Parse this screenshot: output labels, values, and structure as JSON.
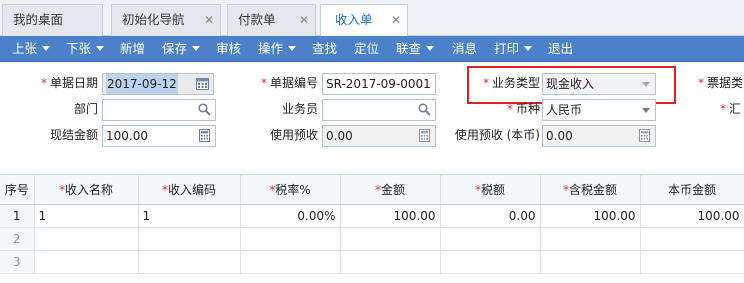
{
  "tabs": [
    {
      "label": "我的桌面",
      "closable": false,
      "active": false
    },
    {
      "label": "初始化导航",
      "closable": true,
      "active": false
    },
    {
      "label": "付款单",
      "closable": true,
      "active": false
    },
    {
      "label": "收入单",
      "closable": true,
      "active": true
    }
  ],
  "toolbar": {
    "items": [
      {
        "label": "上张",
        "dropdown": true
      },
      {
        "label": "下张",
        "dropdown": true
      },
      {
        "label": "新增",
        "dropdown": false
      },
      {
        "label": "保存",
        "dropdown": true
      },
      {
        "label": "审核",
        "dropdown": false
      },
      {
        "label": "操作",
        "dropdown": true
      },
      {
        "label": "查找",
        "dropdown": false
      },
      {
        "label": "定位",
        "dropdown": false
      },
      {
        "label": "联查",
        "dropdown": true
      },
      {
        "label": "消息",
        "dropdown": false
      },
      {
        "label": "打印",
        "dropdown": true
      },
      {
        "label": "退出",
        "dropdown": false
      }
    ]
  },
  "form": {
    "doc_date": {
      "label": "单据日期",
      "value": "2017-09-12"
    },
    "doc_no": {
      "label": "单据编号",
      "value": "SR-2017-09-0001"
    },
    "biz_type": {
      "label": "业务类型",
      "value": "现金收入"
    },
    "bill_type": {
      "label": "票据类"
    },
    "dept": {
      "label": "部门",
      "value": ""
    },
    "staff": {
      "label": "业务员",
      "value": ""
    },
    "currency": {
      "label": "币种",
      "value": "人民币"
    },
    "rate": {
      "label": "汇"
    },
    "cash_amount": {
      "label": "现结金额",
      "value": "100.00"
    },
    "prepay": {
      "label": "使用预收",
      "value": "0.00"
    },
    "prepay_local": {
      "label": "使用预收 (本币)",
      "value": "0.00"
    }
  },
  "grid": {
    "columns": [
      {
        "label": "序号",
        "required": false
      },
      {
        "label": "收入名称",
        "required": true
      },
      {
        "label": "收入编码",
        "required": true
      },
      {
        "label": "税率%",
        "required": true
      },
      {
        "label": "金额",
        "required": true
      },
      {
        "label": "税额",
        "required": true
      },
      {
        "label": "含税金额",
        "required": true
      },
      {
        "label": "本币金额",
        "required": false
      }
    ],
    "rows": [
      [
        "1",
        "1",
        "1",
        "0.00%",
        "100.00",
        "0.00",
        "100.00",
        "100.00"
      ],
      [
        "2",
        "",
        "",
        "",
        "",
        "",
        "",
        ""
      ],
      [
        "3",
        "",
        "",
        "",
        "",
        "",
        "",
        ""
      ]
    ]
  },
  "colors": {
    "toolbar_bg": "#4a81c9",
    "active_tab_text": "#1a73c8",
    "required_mark": "#e03030",
    "highlight_border": "#e02020"
  }
}
